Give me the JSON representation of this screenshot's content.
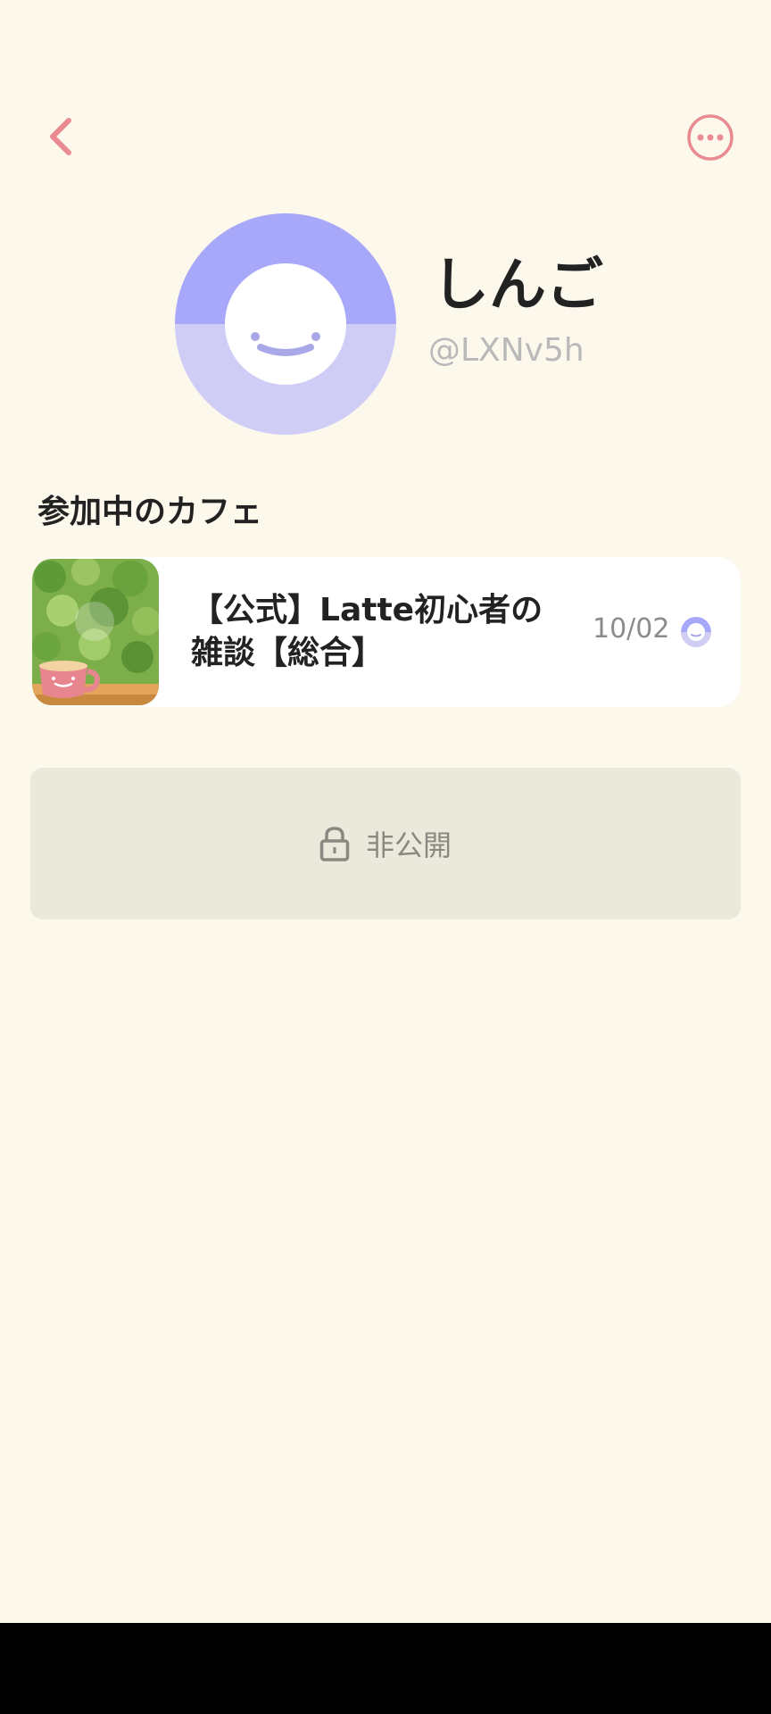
{
  "header": {
    "back_icon": "chevron-left-icon",
    "more_icon": "more-horizontal-circle-icon",
    "accent_color": "#ea8a92"
  },
  "profile": {
    "avatar_icon": "smiley-face-avatar",
    "display_name": "しんご",
    "handle": "@LXNv5h",
    "avatar_colors": [
      "#a8a8fb",
      "#cfcdf6"
    ]
  },
  "cafes_section": {
    "title": "参加中のカフェ",
    "items": [
      {
        "thumbnail_icon": "coffee-cup-on-leaves-image",
        "name_line1": "【公式】Latte初心者の",
        "name_line2": "雑談【総合】",
        "date": "10/02",
        "member_avatar_icon": "smiley-face-avatar"
      }
    ]
  },
  "privacy": {
    "icon": "lock-icon",
    "label": "非公開"
  }
}
